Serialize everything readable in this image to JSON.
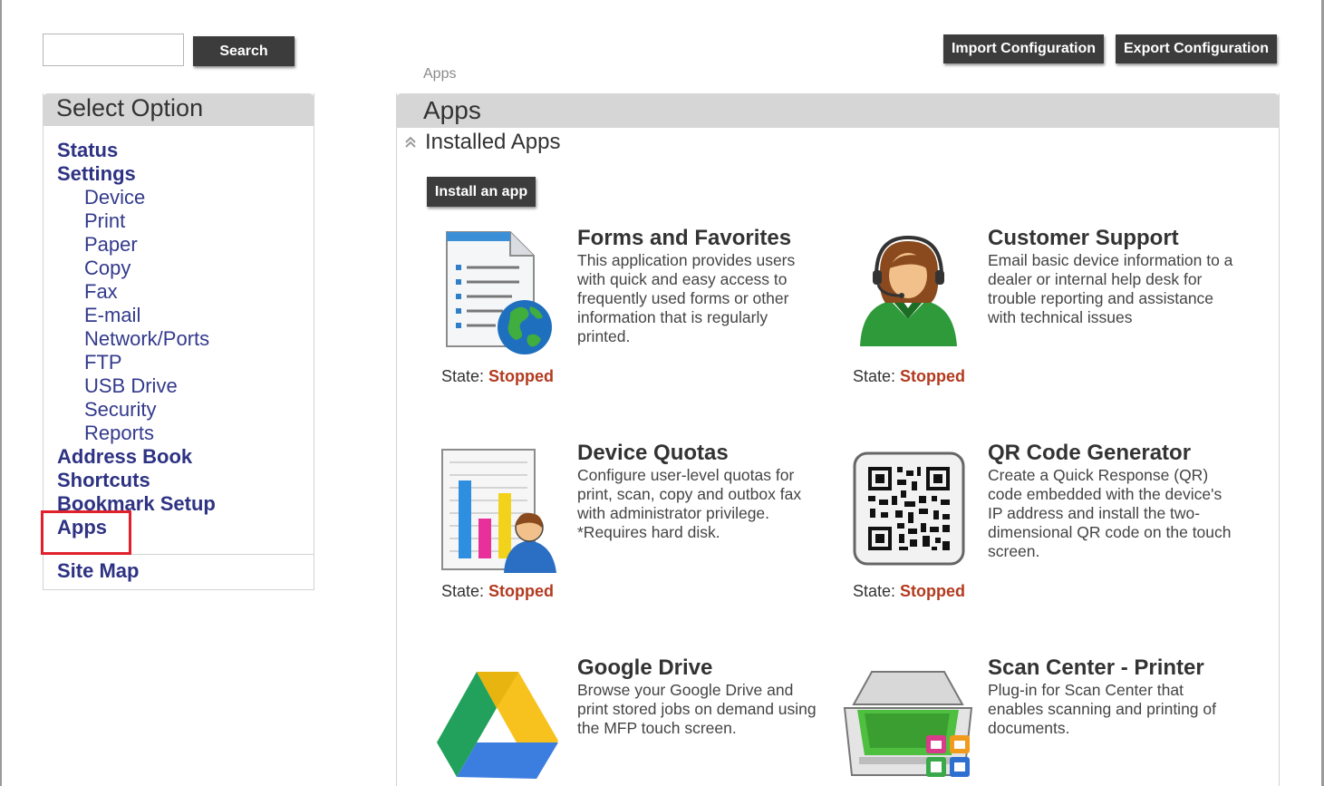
{
  "search": {
    "placeholder": "",
    "button_label": "Search"
  },
  "top_actions": {
    "import_label": "Import Configuration",
    "export_label": "Export Configuration"
  },
  "breadcrumb": "Apps",
  "sidebar": {
    "title": "Select Option",
    "items": [
      {
        "label": "Status",
        "level": 0
      },
      {
        "label": "Settings",
        "level": 0
      },
      {
        "label": "Device",
        "level": 1
      },
      {
        "label": "Print",
        "level": 1
      },
      {
        "label": "Paper",
        "level": 1
      },
      {
        "label": "Copy",
        "level": 1
      },
      {
        "label": "Fax",
        "level": 1
      },
      {
        "label": "E-mail",
        "level": 1
      },
      {
        "label": "Network/Ports",
        "level": 1
      },
      {
        "label": "FTP",
        "level": 1
      },
      {
        "label": "USB Drive",
        "level": 1
      },
      {
        "label": "Security",
        "level": 1
      },
      {
        "label": "Reports",
        "level": 1
      },
      {
        "label": "Address Book",
        "level": 0
      },
      {
        "label": "Shortcuts",
        "level": 0
      },
      {
        "label": "Bookmark Setup",
        "level": 0
      },
      {
        "label": "Apps",
        "level": 0,
        "selected": true
      }
    ],
    "footer_item": "Site Map",
    "highlight_color": "#e0202a"
  },
  "main": {
    "title": "Apps",
    "section_title": "Installed Apps",
    "install_button": "Install an app",
    "state_label": "State:",
    "apps": [
      {
        "title": "Forms and Favorites",
        "description": "This application provides users with quick and easy access to frequently used forms or other information that is regularly printed.",
        "state": "Stopped",
        "icon": "document-globe-icon"
      },
      {
        "title": "Customer Support",
        "description": "Email basic device information to a dealer or internal help desk for trouble reporting and assistance with technical issues",
        "state": "Stopped",
        "icon": "support-agent-icon"
      },
      {
        "title": "Device Quotas",
        "description": "Configure user-level quotas for print, scan, copy and outbox fax with administrator privilege. *Requires hard disk.",
        "state": "Stopped",
        "icon": "quota-chart-icon"
      },
      {
        "title": "QR Code Generator",
        "description": "Create a Quick Response (QR) code embedded with the device's IP address and install the two-dimensional QR code on the touch screen.",
        "state": "Stopped",
        "icon": "qr-code-icon"
      },
      {
        "title": "Google Drive",
        "description": "Browse your Google Drive and print stored jobs on demand using the MFP touch screen.",
        "state": "",
        "icon": "google-drive-icon"
      },
      {
        "title": "Scan Center - Printer",
        "description": "Plug-in for Scan Center that enables scanning and printing of documents.",
        "state": "",
        "icon": "scanner-icon"
      }
    ]
  },
  "colors": {
    "nav_link": "#2d3283",
    "state_stopped": "#b33a1f",
    "header_bg": "#d6d6d6",
    "button_bg": "#3c3c3c"
  }
}
